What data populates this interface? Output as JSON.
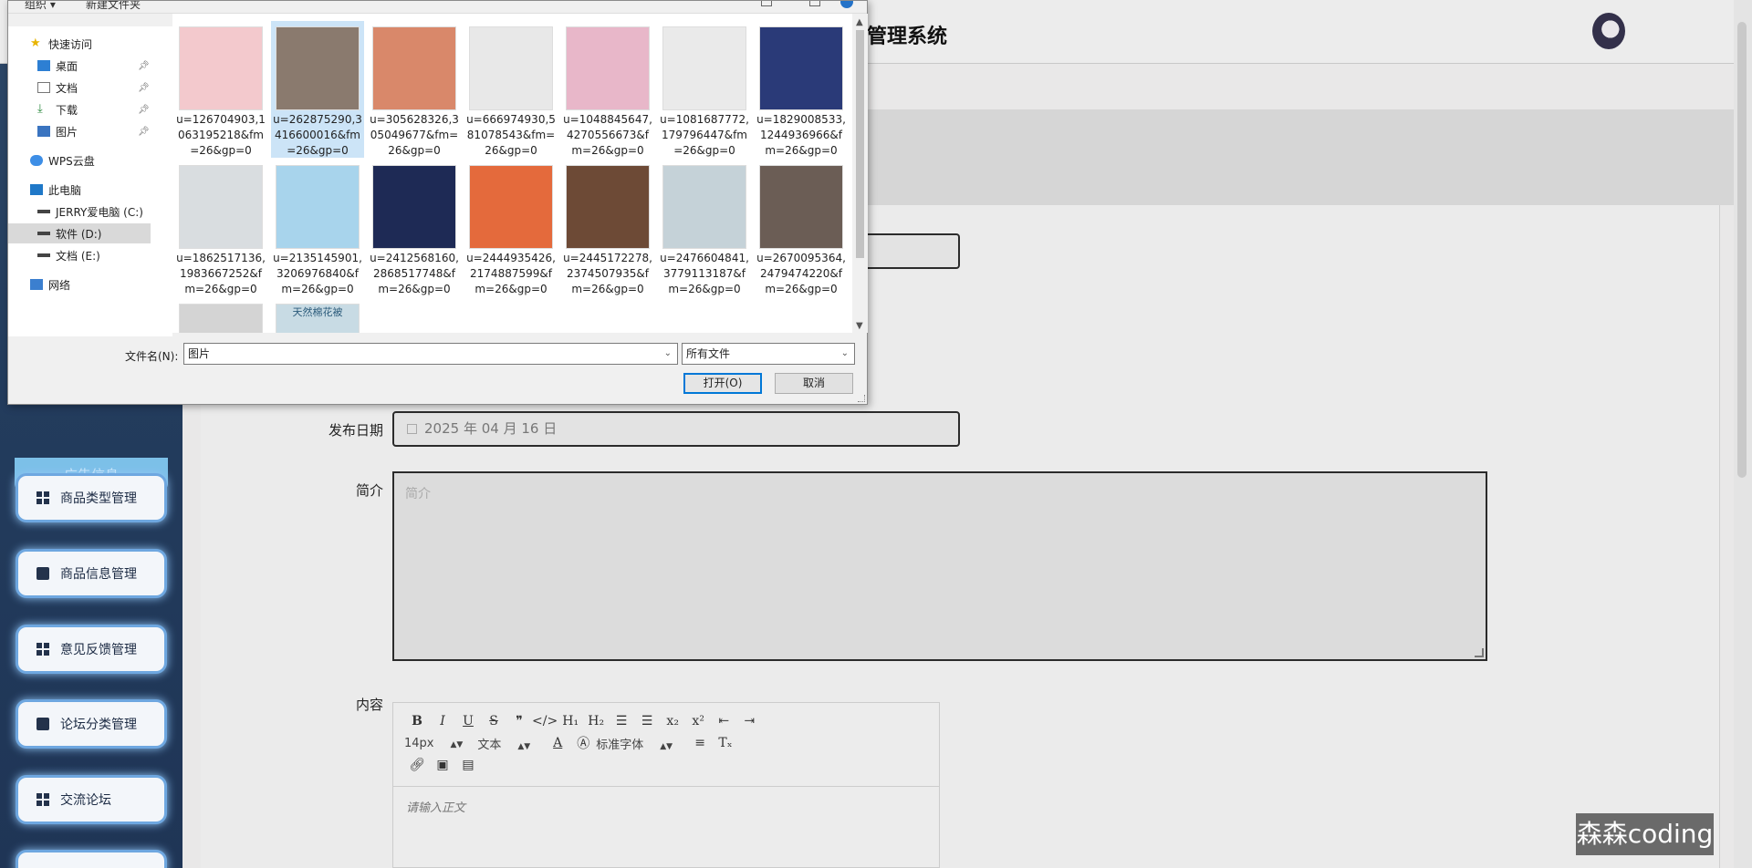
{
  "app": {
    "title": "管理系统",
    "sidebar": {
      "ad_label": "广告信息",
      "items": [
        {
          "label": "商品类型管理",
          "icon": "grid-icon"
        },
        {
          "label": "商品信息管理",
          "icon": "wallet-icon"
        },
        {
          "label": "意见反馈管理",
          "icon": "grid-icon"
        },
        {
          "label": "论坛分类管理",
          "icon": "briefcase-icon"
        },
        {
          "label": "交流论坛",
          "icon": "grid-icon"
        }
      ]
    },
    "form": {
      "date_label": "发布日期",
      "date_value": "2025 年 04 月 16 日",
      "intro_label": "简介",
      "intro_placeholder": "简介",
      "content_label": "内容",
      "editor": {
        "font_size": "14px",
        "paragraph": "文本",
        "font_family": "标准字体",
        "placeholder": "请输入正文"
      }
    },
    "watermark": "森森coding"
  },
  "dialog": {
    "toolbar": {
      "organize": "组织 ▾",
      "new_folder": "新建文件夹"
    },
    "nav": [
      {
        "label": "快速访问",
        "icon": "star-icon"
      },
      {
        "label": "桌面",
        "icon": "desktop-icon",
        "pinned": true
      },
      {
        "label": "文档",
        "icon": "document-icon",
        "pinned": true
      },
      {
        "label": "下载",
        "icon": "download-icon",
        "pinned": true
      },
      {
        "label": "图片",
        "icon": "picture-icon",
        "pinned": true
      },
      {
        "label": "WPS云盘",
        "icon": "cloud-icon"
      },
      {
        "label": "此电脑",
        "icon": "computer-icon"
      },
      {
        "label": "JERRY爱电脑 (C:)",
        "icon": "drive-icon"
      },
      {
        "label": "软件 (D:)",
        "icon": "drive-icon",
        "selected": true
      },
      {
        "label": "文档 (E:)",
        "icon": "drive-icon"
      },
      {
        "label": "网络",
        "icon": "network-icon"
      }
    ],
    "files": [
      {
        "name": "u=126704903,1063195218&fm=26&gp=0",
        "color": "#f3c9cd"
      },
      {
        "name": "u=262875290,3416600016&fm=26&gp=0",
        "color": "#8a7a6e",
        "selected": true
      },
      {
        "name": "u=305628326,305049677&fm=26&gp=0",
        "color": "#d9886a"
      },
      {
        "name": "u=666974930,581078543&fm=26&gp=0",
        "color": "#e8e8e8"
      },
      {
        "name": "u=1048845647,4270556673&fm=26&gp=0",
        "color": "#e8b7c9"
      },
      {
        "name": "u=1081687772,179796447&fm=26&gp=0",
        "color": "#eaeaea"
      },
      {
        "name": "u=1829008533,1244936966&fm=26&gp=0",
        "color": "#2a3a78"
      },
      {
        "name": "u=1862517136,1983667252&fm=26&gp=0",
        "color": "#d9dde0"
      },
      {
        "name": "u=2135145901,3206976840&fm=26&gp=0",
        "color": "#a8d4ec"
      },
      {
        "name": "u=2412568160,2868517748&fm=26&gp=0",
        "color": "#1e2a55"
      },
      {
        "name": "u=2444935426,2174887599&fm=26&gp=0",
        "color": "#e46a3c"
      },
      {
        "name": "u=2445172278,2374507935&fm=26&gp=0",
        "color": "#6d4a36"
      },
      {
        "name": "u=2476604841,3779113187&fm=26&gp=0",
        "color": "#c5d2d8"
      },
      {
        "name": "u=2670095364,2479474220&fm=26&gp=0",
        "color": "#6b5d55"
      },
      {
        "name": "",
        "color": "#d4d4d4"
      },
      {
        "name": "",
        "color": "#c8dbe4",
        "thumb_text": "天然棉花被"
      }
    ],
    "filename_label": "文件名(N):",
    "filename_value": "图片",
    "filetype_value": "所有文件",
    "open_label": "打开(O)",
    "cancel_label": "取消"
  }
}
